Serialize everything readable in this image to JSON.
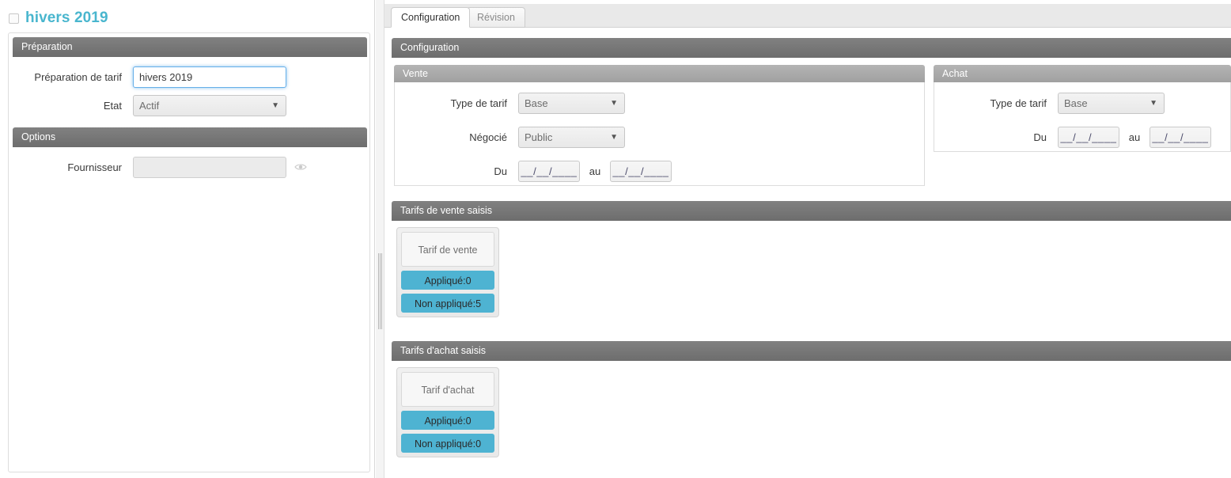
{
  "header": {
    "title": "hivers 2019",
    "checkbox_checked": false,
    "title_color": "#49b6ce"
  },
  "left": {
    "preparation": {
      "panel_title": "Préparation",
      "fields": {
        "preparation_tarif_label": "Préparation de tarif",
        "preparation_tarif_value": "hivers 2019",
        "etat_label": "Etat",
        "etat_value": "Actif"
      }
    },
    "options": {
      "panel_title": "Options",
      "fields": {
        "fournisseur_label": "Fournisseur",
        "fournisseur_value": "",
        "fournisseur_placeholder": "",
        "eye_icon": "eye-icon"
      }
    }
  },
  "right": {
    "tabs": [
      {
        "label": "Configuration",
        "active": true
      },
      {
        "label": "Révision",
        "active": false
      }
    ],
    "configuration": {
      "panel_title": "Configuration",
      "vente": {
        "panel_title": "Vente",
        "type_tarif_label": "Type de tarif",
        "type_tarif_value": "Base",
        "negocie_label": "Négocié",
        "negocie_value": "Public",
        "du_label": "Du",
        "du_value": "__/__/____",
        "au_label": "au",
        "au_value": "__/__/____"
      },
      "achat": {
        "panel_title": "Achat",
        "type_tarif_label": "Type de tarif",
        "type_tarif_value": "Base",
        "du_label": "Du",
        "du_value": "__/__/____",
        "au_label": "au",
        "au_value": "__/__/____"
      }
    },
    "tarifs_vente": {
      "panel_title": "Tarifs de vente saisis",
      "box_title": "Tarif de vente",
      "applique_label": "Appliqué:0",
      "non_applique_label": "Non appliqué:5"
    },
    "tarifs_achat": {
      "panel_title": "Tarifs d'achat saisis",
      "box_title": "Tarif d'achat",
      "applique_label": "Appliqué:0",
      "non_applique_label": "Non appliqué:0"
    }
  },
  "colors": {
    "accent_blue": "#4eb3d2",
    "panel_header_dark": "#757575",
    "panel_header_light": "#a8a8a8",
    "title_teal": "#49b6ce"
  }
}
